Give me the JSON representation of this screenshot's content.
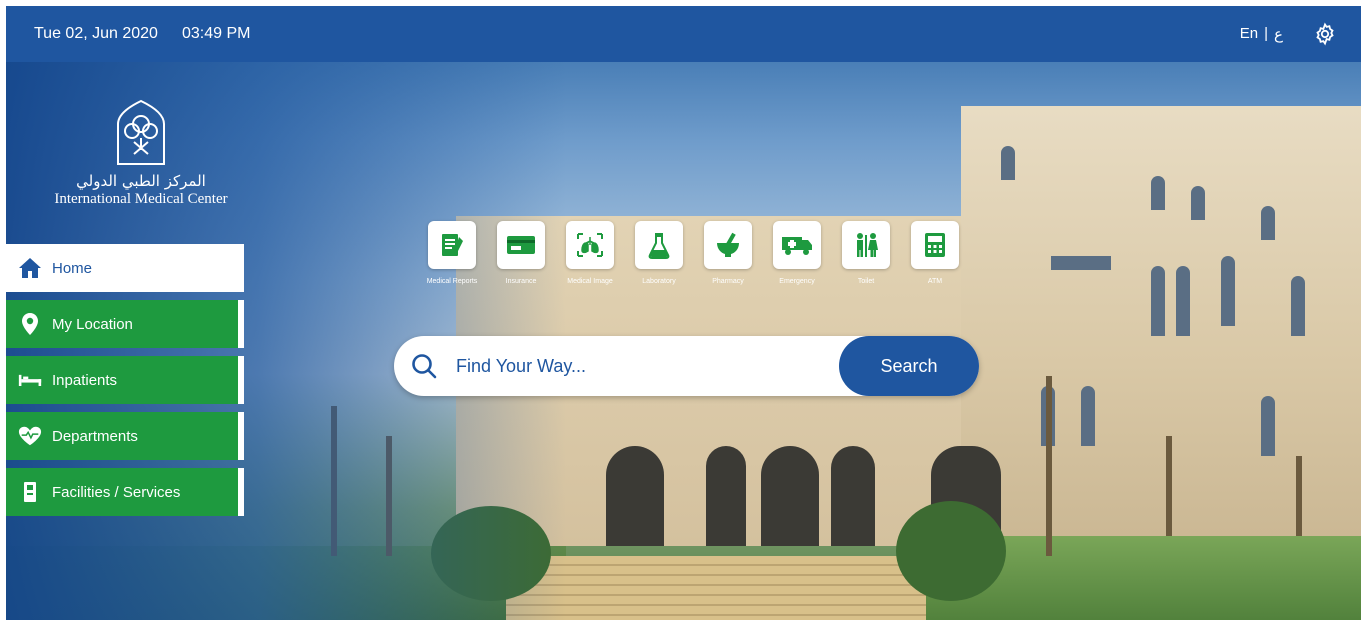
{
  "header": {
    "date": "Tue 02, Jun 2020",
    "time": "03:49 PM",
    "lang_en": "En",
    "lang_separator": "|",
    "lang_ar": "ع",
    "icons": {
      "settings": "gear-icon"
    }
  },
  "logo": {
    "arabic_name": "المركز الطبي الدولي",
    "english_name": "International Medical Center"
  },
  "sidebar": {
    "items": [
      {
        "label": "Home",
        "icon": "home-icon",
        "active": true
      },
      {
        "label": "My Location",
        "icon": "location-pin-icon"
      },
      {
        "label": "Inpatients",
        "icon": "bed-icon"
      },
      {
        "label": "Departments",
        "icon": "heart-pulse-icon"
      },
      {
        "label": "Facilities / Services",
        "icon": "phone-booth-icon"
      }
    ]
  },
  "categories": [
    {
      "label": "Medical Reports",
      "icon": "medical-report-icon"
    },
    {
      "label": "Insurance",
      "icon": "insurance-card-icon"
    },
    {
      "label": "Medical Image",
      "icon": "xray-lungs-icon"
    },
    {
      "label": "Laboratory",
      "icon": "flask-icon"
    },
    {
      "label": "Pharmacy",
      "icon": "mortar-pestle-icon"
    },
    {
      "label": "Emergency",
      "icon": "ambulance-icon"
    },
    {
      "label": "Toilet",
      "icon": "restroom-icon"
    },
    {
      "label": "ATM",
      "icon": "atm-icon"
    }
  ],
  "search": {
    "placeholder": "Find Your Way...",
    "value": "",
    "button_label": "Search"
  },
  "colors": {
    "brand_blue": "#1f56a0",
    "nav_green": "#1e9a3f",
    "icon_green": "#1e9a3f"
  }
}
